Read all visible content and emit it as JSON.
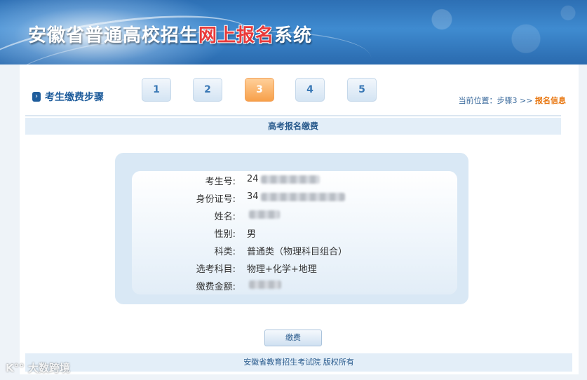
{
  "header": {
    "title_part1": "安徽省普通高校招生",
    "title_highlight": "网上报名",
    "title_part2": "系统"
  },
  "steps": {
    "heading": "考生缴费步骤",
    "items": [
      "1",
      "2",
      "3",
      "4",
      "5"
    ],
    "active_index": 2
  },
  "breadcrumb": {
    "prefix": "当前位置：",
    "path": "步骤3 >> ",
    "current": "报名信息"
  },
  "section_title": "高考报名缴费",
  "form": {
    "rows": [
      {
        "label": "考生号:",
        "value": "24"
      },
      {
        "label": "身份证号:",
        "value": "34"
      },
      {
        "label": "姓名:",
        "value": ""
      },
      {
        "label": "性别:",
        "value": "男"
      },
      {
        "label": "科类:",
        "value": "普通类（物理科目组合）"
      },
      {
        "label": "选考科目:",
        "value": "物理+化学+地理"
      },
      {
        "label": "缴费金额:",
        "value": ""
      }
    ]
  },
  "pay_button": "缴费",
  "footer": "安徽省教育招生考试院 版权所有",
  "watermark": "K°° 大数跨境",
  "colors": {
    "accent_blue": "#1f5d9c",
    "active_step": "#f7a04a",
    "highlight_orange": "#e8760f",
    "title_red": "#e83a3a"
  }
}
